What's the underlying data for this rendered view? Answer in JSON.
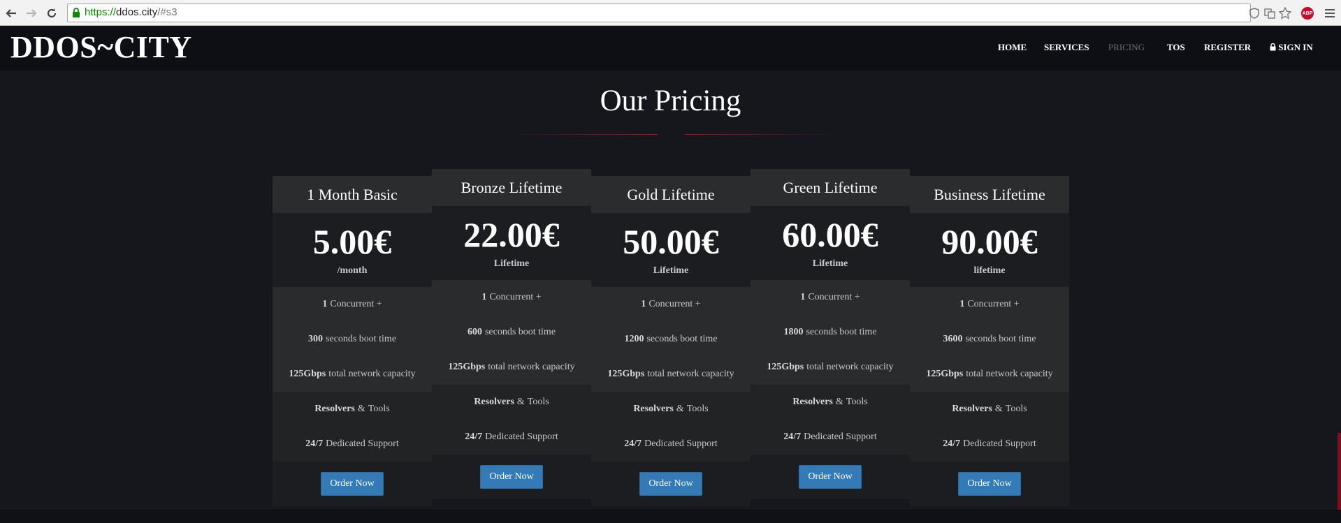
{
  "browser": {
    "url_scheme": "https://",
    "url_host": "ddos.city",
    "url_path": "/#s3",
    "abp_label": "ABP"
  },
  "site": {
    "brand": "DDOS~CITY",
    "nav": [
      {
        "label": "HOME"
      },
      {
        "label": "SERVICES"
      },
      {
        "label": "PRICING"
      },
      {
        "label": "TOS"
      },
      {
        "label": "REGISTER"
      },
      {
        "label": "SIGN IN"
      }
    ]
  },
  "pricing": {
    "title": "Our Pricing",
    "accent_color": "#b01428",
    "button_color": "#337ab7",
    "plans": [
      {
        "name": "1 Month Basic",
        "price": "5.00€",
        "period": "/month",
        "concurrent_num": "1",
        "concurrent_text": "Concurrent +",
        "boot_num": "300",
        "boot_text": "seconds boot time",
        "capacity_num": "125Gbps",
        "capacity_text": "total network capacity",
        "resolvers_bold": "Resolvers",
        "resolvers_amp": "&",
        "resolvers_text": "Tools",
        "support_num": "24/7",
        "support_text": "Dedicated Support",
        "button": "Order Now"
      },
      {
        "name": "Bronze Lifetime",
        "price": "22.00€",
        "period": "Lifetime",
        "concurrent_num": "1",
        "concurrent_text": "Concurrent +",
        "boot_num": "600",
        "boot_text": "seconds boot time",
        "capacity_num": "125Gbps",
        "capacity_text": "total network capacity",
        "resolvers_bold": "Resolvers",
        "resolvers_amp": "&",
        "resolvers_text": "Tools",
        "support_num": "24/7",
        "support_text": "Dedicated Support",
        "button": "Order Now"
      },
      {
        "name": "Gold Lifetime",
        "price": "50.00€",
        "period": "Lifetime",
        "concurrent_num": "1",
        "concurrent_text": "Concurrent +",
        "boot_num": "1200",
        "boot_text": "seconds boot time",
        "capacity_num": "125Gbps",
        "capacity_text": "total network capacity",
        "resolvers_bold": "Resolvers",
        "resolvers_amp": "&",
        "resolvers_text": "Tools",
        "support_num": "24/7",
        "support_text": "Dedicated Support",
        "button": "Order Now"
      },
      {
        "name": "Green Lifetime",
        "price": "60.00€",
        "period": "Lifetime",
        "concurrent_num": "1",
        "concurrent_text": "Concurrent +",
        "boot_num": "1800",
        "boot_text": "seconds boot time",
        "capacity_num": "125Gbps",
        "capacity_text": "total network capacity",
        "resolvers_bold": "Resolvers",
        "resolvers_amp": "&",
        "resolvers_text": "Tools",
        "support_num": "24/7",
        "support_text": "Dedicated Support",
        "button": "Order Now"
      },
      {
        "name": "Business Lifetime",
        "price": "90.00€",
        "period": "lifetime",
        "concurrent_num": "1",
        "concurrent_text": "Concurrent +",
        "boot_num": "3600",
        "boot_text": "seconds boot time",
        "capacity_num": "125Gbps",
        "capacity_text": "total network capacity",
        "resolvers_bold": "Resolvers",
        "resolvers_amp": "&",
        "resolvers_text": "Tools",
        "support_num": "24/7",
        "support_text": "Dedicated Support",
        "button": "Order Now"
      }
    ]
  }
}
